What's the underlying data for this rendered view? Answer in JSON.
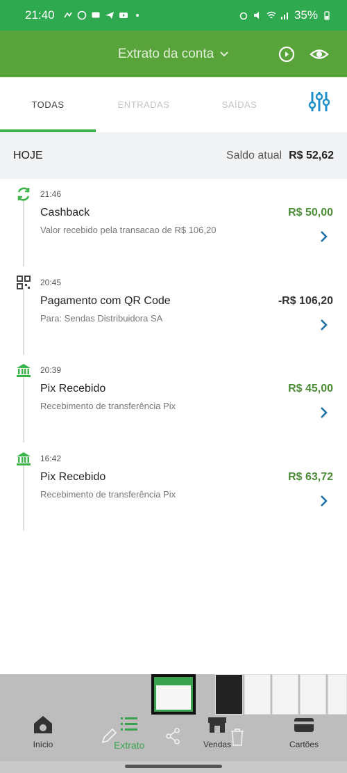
{
  "status_bar": {
    "time": "21:40",
    "battery": "35%"
  },
  "app_bar": {
    "title": "Extrato da conta"
  },
  "tabs": [
    {
      "label": "TODAS",
      "active": true
    },
    {
      "label": "ENTRADAS",
      "active": false
    },
    {
      "label": "SAÍDAS",
      "active": false
    }
  ],
  "day_header": {
    "day": "HOJE",
    "balance_label": "Saldo atual",
    "balance_value": "R$ 52,62"
  },
  "transactions": [
    {
      "icon": "cashback-icon",
      "time": "21:46",
      "name": "Cashback",
      "description": "Valor recebido pela transacao de R$ 106,20",
      "amount": "R$ 50,00",
      "type": "positive"
    },
    {
      "icon": "qr-code-icon",
      "time": "20:45",
      "name": "Pagamento com QR Code",
      "description": "Para: Sendas Distribuidora SA",
      "amount": "-R$ 106,20",
      "type": "negative"
    },
    {
      "icon": "bank-icon",
      "time": "20:39",
      "name": "Pix Recebido",
      "description": "Recebimento de transferência Pix",
      "amount": "R$ 45,00",
      "type": "positive"
    },
    {
      "icon": "bank-icon",
      "time": "16:42",
      "name": "Pix Recebido",
      "description": "Recebimento de transferência Pix",
      "amount": "R$ 63,72",
      "type": "positive"
    }
  ],
  "bottom_nav": {
    "home": "Início",
    "statement": "Extrato",
    "sales": "Vendas",
    "cards": "Cartões"
  },
  "colors": {
    "status_bar": "#2fa94f",
    "app_bar": "#58a33a",
    "accent": "#3bb54a",
    "positive": "#4a8c35",
    "link": "#1f6fa8"
  }
}
